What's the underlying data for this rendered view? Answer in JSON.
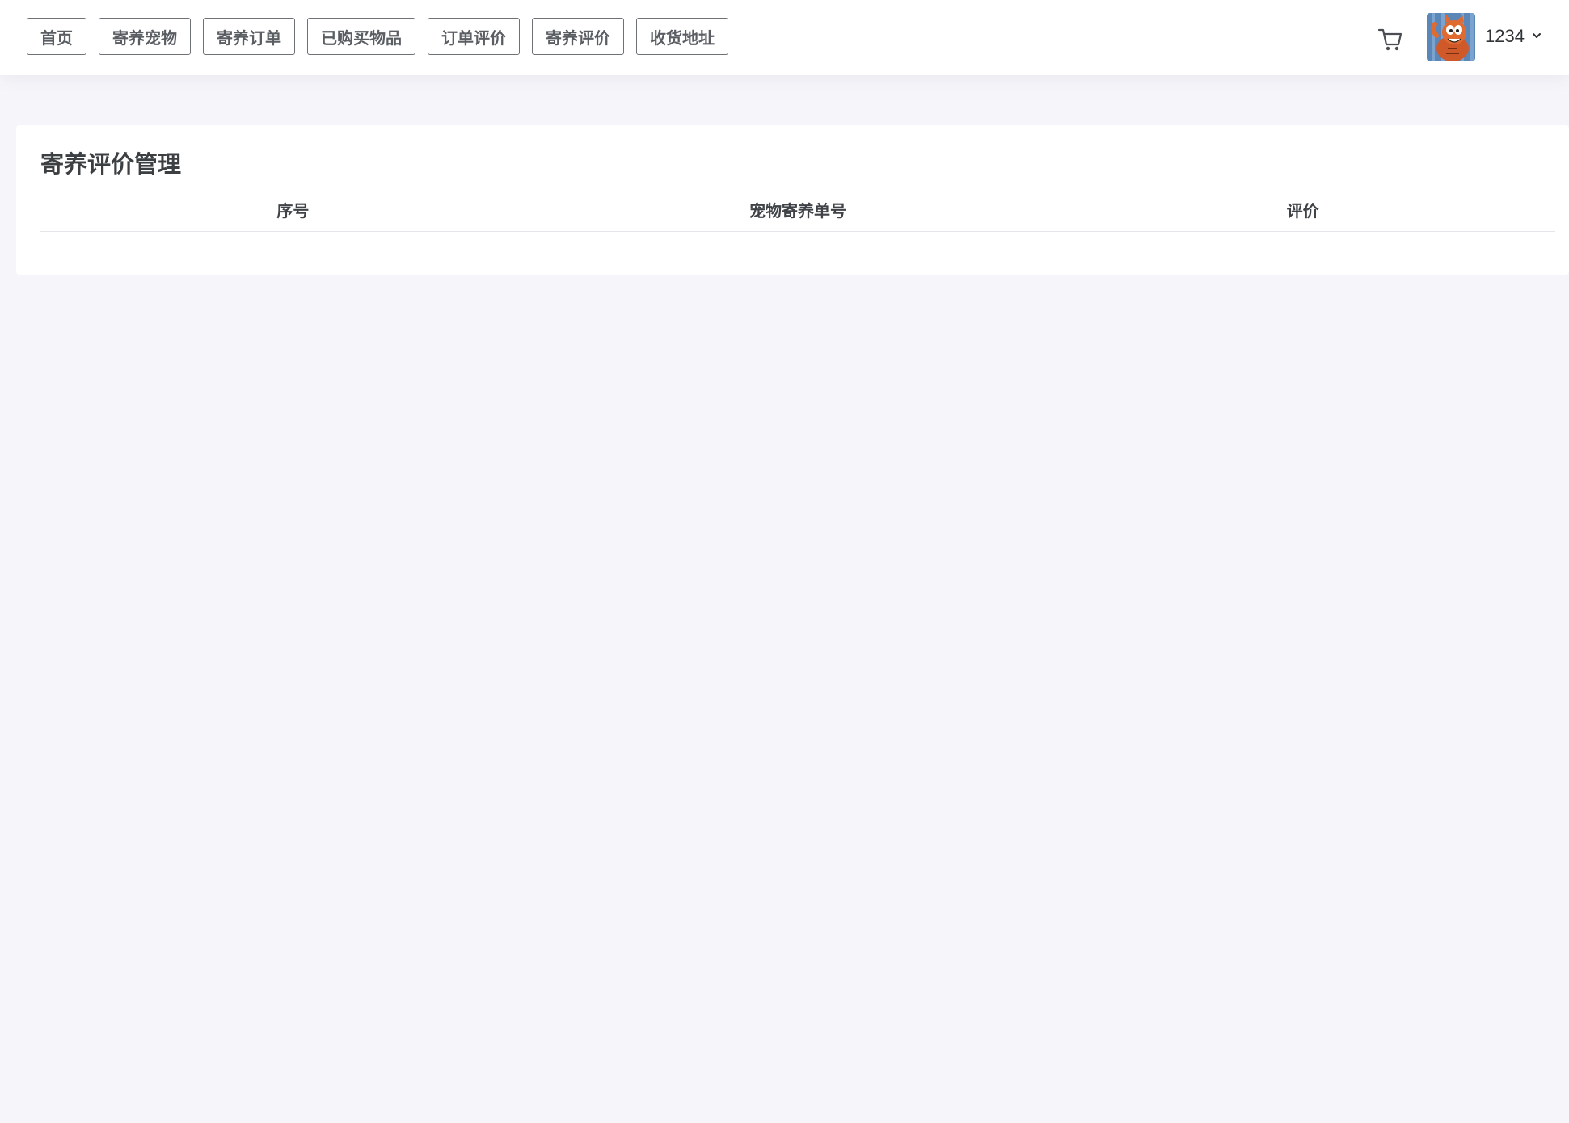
{
  "nav": {
    "items": [
      {
        "label": "首页"
      },
      {
        "label": "寄养宠物"
      },
      {
        "label": "寄养订单"
      },
      {
        "label": "已购买物品"
      },
      {
        "label": "订单评价"
      },
      {
        "label": "寄养评价"
      },
      {
        "label": "收货地址"
      }
    ]
  },
  "header": {
    "cart_icon": "shopping-cart-icon",
    "avatar_icon": "cartoon-cat-avatar",
    "username": "1234",
    "dropdown_icon": "chevron-down-icon"
  },
  "main": {
    "title": "寄养评价管理",
    "table": {
      "columns": [
        "序号",
        "宠物寄养单号",
        "评价"
      ],
      "rows": []
    }
  },
  "colors": {
    "page_background": "#f6f6fa",
    "card_background": "#ffffff",
    "nav_border": "#6e7276",
    "text": "#3c4043"
  }
}
